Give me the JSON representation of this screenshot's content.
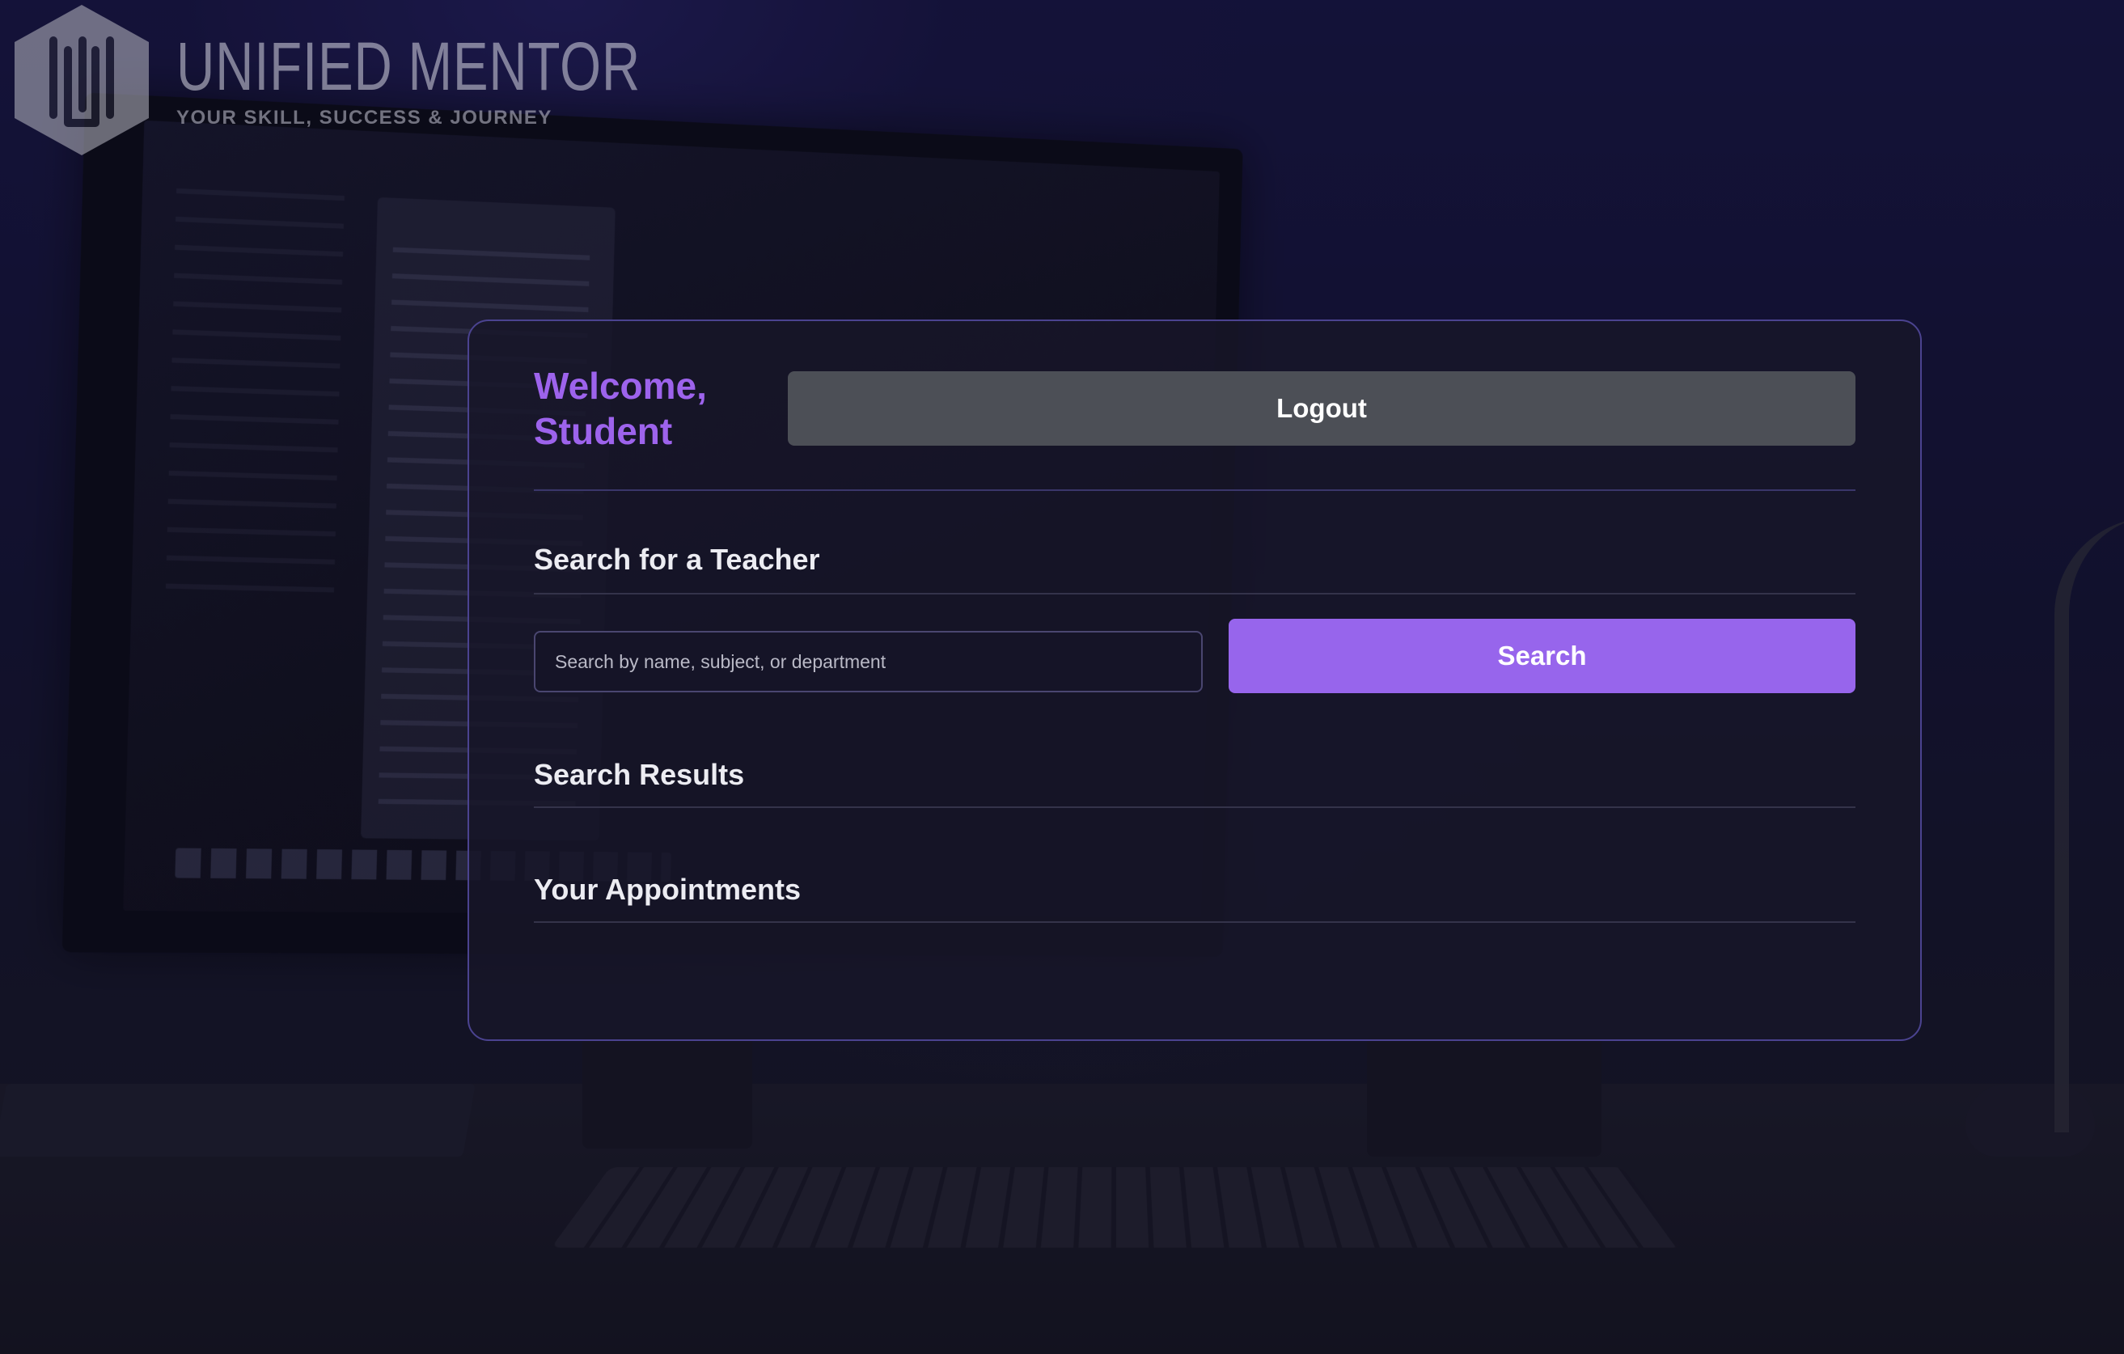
{
  "logo": {
    "title": "UNIFIED MENTOR",
    "subtitle": "YOUR SKILL, SUCCESS & JOURNEY",
    "icon": "unified-mentor-hexagon-logo"
  },
  "header": {
    "welcome": "Welcome, Student",
    "logout_label": "Logout"
  },
  "search": {
    "title": "Search for a Teacher",
    "placeholder": "Search by name, subject, or department",
    "value": "",
    "button_label": "Search"
  },
  "results": {
    "title": "Search Results",
    "items": []
  },
  "appointments": {
    "title": "Your Appointments",
    "items": []
  },
  "colors": {
    "accent": "#9765ec",
    "welcome_text": "#9d63ec",
    "logout_button": "#4c4f56",
    "card_border": "#4b4390"
  }
}
